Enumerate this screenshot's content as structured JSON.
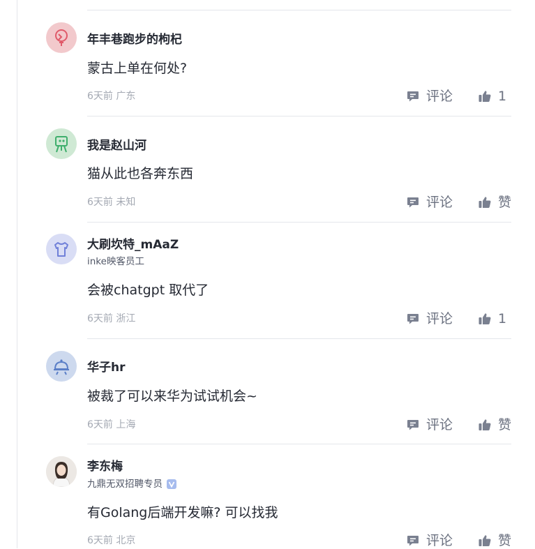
{
  "comments": [
    {
      "name": "年丰巷跑步的枸杞",
      "title": "",
      "verified": false,
      "content": "蒙古上单在何处?",
      "time": "6天前",
      "location": "广东",
      "reply_label": "评论",
      "like_label": "1",
      "avatar_icon": "robot-avatar-icon",
      "avatar_color": "#f2c9cc"
    },
    {
      "name": "我是赵山河",
      "title": "",
      "verified": false,
      "content": "猫从此也各奔东西",
      "time": "6天前",
      "location": "未知",
      "reply_label": "评论",
      "like_label": "赞",
      "avatar_icon": "easel-avatar-icon",
      "avatar_color": "#cfe9d4"
    },
    {
      "name": "大刷坎特_mAaZ",
      "title": "inke映客员工",
      "verified": false,
      "content": "会被chatgpt 取代了",
      "time": "6天前",
      "location": "浙江",
      "reply_label": "评论",
      "like_label": "1",
      "avatar_icon": "shirt-avatar-icon",
      "avatar_color": "#d9ddf5"
    },
    {
      "name": "华子hr",
      "title": "",
      "verified": false,
      "content": "被裁了可以来华为试试机会~",
      "time": "6天前",
      "location": "上海",
      "reply_label": "评论",
      "like_label": "赞",
      "avatar_icon": "cloche-avatar-icon",
      "avatar_color": "#cdd9ee"
    },
    {
      "name": "李东梅",
      "title": "九鼎无双招聘专员",
      "verified": true,
      "content": "有Golang后端开发嘛?  可以找我",
      "time": "6天前",
      "location": "北京",
      "reply_label": "评论",
      "like_label": "赞",
      "avatar_icon": "user-photo-avatar",
      "avatar_color": "#e8e4e0"
    }
  ]
}
